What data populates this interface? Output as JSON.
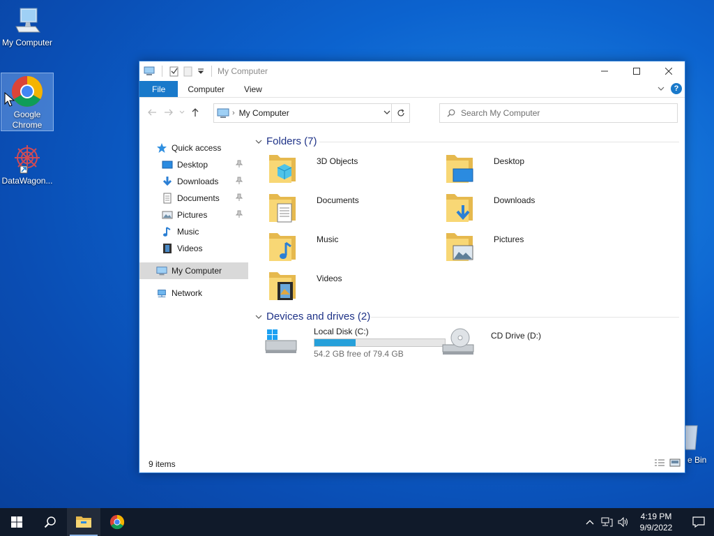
{
  "desktop": {
    "icons": [
      {
        "label": "My Computer"
      },
      {
        "label": "Google Chrome"
      },
      {
        "label": "DataWagon..."
      }
    ],
    "recycle_label": "e Bin"
  },
  "window": {
    "title": "My Computer",
    "ribbon": {
      "tabs": [
        "File",
        "Computer",
        "View"
      ],
      "help": "?"
    },
    "address": {
      "location": "My Computer"
    },
    "search": {
      "placeholder": "Search My Computer"
    },
    "nav": {
      "quick_access": "Quick access",
      "pinned": [
        "Desktop",
        "Downloads",
        "Documents",
        "Pictures"
      ],
      "unpinned": [
        "Music",
        "Videos"
      ],
      "this_pc": "My Computer",
      "network": "Network"
    },
    "folders_header": "Folders (7)",
    "folders": [
      "3D Objects",
      "Desktop",
      "Documents",
      "Downloads",
      "Music",
      "Pictures",
      "Videos"
    ],
    "devices_header": "Devices and drives (2)",
    "drives": [
      {
        "name": "Local Disk (C:)",
        "free_text": "54.2 GB free of 79.4 GB",
        "used_fraction": 0.317
      },
      {
        "name": "CD Drive (D:)"
      }
    ],
    "status": "9 items"
  },
  "taskbar": {
    "time": "4:19 PM",
    "date": "9/9/2022"
  },
  "colors": {
    "accent": "#1979ca",
    "drive_bar": "#26a0da",
    "header_text": "#1e3287"
  }
}
